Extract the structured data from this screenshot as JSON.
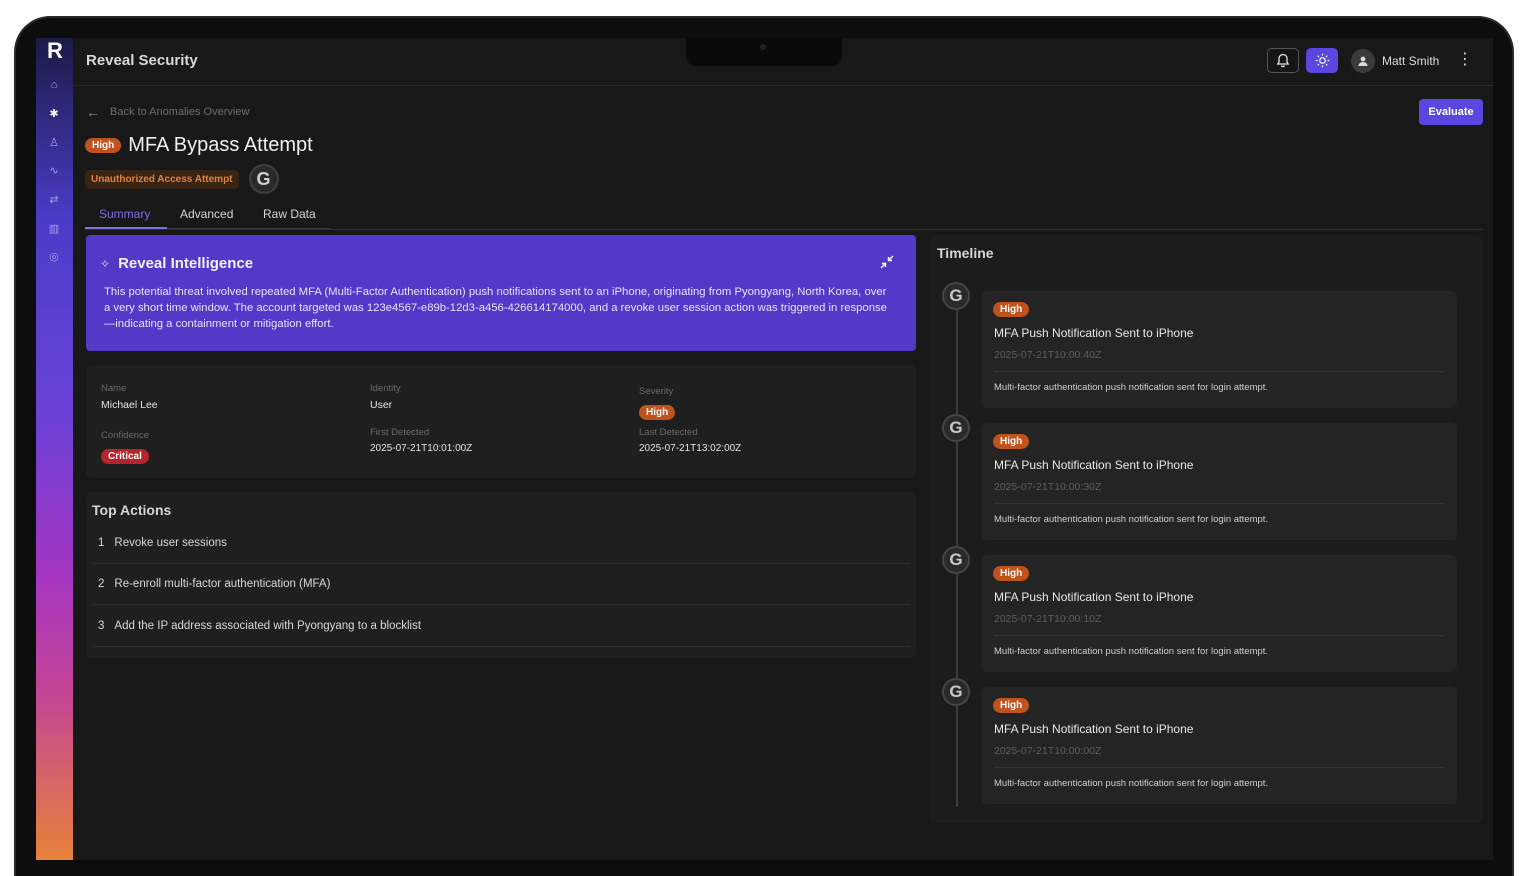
{
  "app": {
    "title": "Reveal Security",
    "logo": "R"
  },
  "header": {
    "user_name": "Matt Smith",
    "icons": [
      "bell-icon",
      "sun-icon",
      "user-icon",
      "kebab-icon"
    ]
  },
  "sidebar": {
    "items": [
      "home-icon",
      "bug-icon",
      "user-icon",
      "activity-icon",
      "workflow-icon",
      "chart-icon",
      "settings-icon"
    ]
  },
  "nav": {
    "back_label": "Back to Anomalies Overview",
    "evaluate_label": "Evaluate"
  },
  "anomaly": {
    "severity": "High",
    "title": "MFA Bypass Attempt",
    "category": "Unauthorized Access Attempt",
    "source_logo": "G"
  },
  "tabs": [
    "Summary",
    "Advanced",
    "Raw Data"
  ],
  "intelligence": {
    "title": "Reveal Intelligence",
    "body": "This potential threat involved repeated MFA (Multi-Factor Authentication) push notifications sent to an iPhone, originating from Pyongyang, North Korea, over a very short time window. The account targeted was 123e4567-e89b-12d3-a456-426614174000, and a revoke user session action was triggered in response—indicating a containment or mitigation effort."
  },
  "details": {
    "name_label": "Name",
    "name": "Michael Lee",
    "identity_label": "Identity",
    "identity": "User",
    "severity_label": "Severity",
    "severity": "High",
    "confidence_label": "Confidence",
    "confidence": "Critical",
    "first_detected_label": "First Detected",
    "first_detected": "2025-07-21T10:01:00Z",
    "last_detected_label": "Last Detected",
    "last_detected": "2025-07-21T13:02:00Z"
  },
  "top_actions": {
    "title": "Top Actions",
    "items": [
      {
        "num": "1",
        "text": "Revoke user sessions"
      },
      {
        "num": "2",
        "text": "Re-enroll multi-factor authentication (MFA)"
      },
      {
        "num": "3",
        "text": "Add the IP address associated with Pyongyang to a blocklist"
      }
    ]
  },
  "timeline": {
    "title": "Timeline",
    "events": [
      {
        "severity": "High",
        "title": "MFA Push Notification Sent to iPhone",
        "time": "2025-07-21T10:00:40Z",
        "desc": "Multi-factor authentication push notification sent for login attempt.",
        "logo": "G"
      },
      {
        "severity": "High",
        "title": "MFA Push Notification Sent to iPhone",
        "time": "2025-07-21T10:00:30Z",
        "desc": "Multi-factor authentication push notification sent for login attempt.",
        "logo": "G"
      },
      {
        "severity": "High",
        "title": "MFA Push Notification Sent to iPhone",
        "time": "2025-07-21T10:00:10Z",
        "desc": "Multi-factor authentication push notification sent for login attempt.",
        "logo": "G"
      },
      {
        "severity": "High",
        "title": "MFA Push Notification Sent to iPhone",
        "time": "2025-07-21T10:00:00Z",
        "desc": "Multi-factor authentication push notification sent for login attempt.",
        "logo": "G"
      }
    ]
  },
  "colors": {
    "accent": "#5b47e0",
    "intel_bg": "#5438c8",
    "high": "#c0531d",
    "critical": "#b8232b",
    "category": "#e0823a"
  }
}
